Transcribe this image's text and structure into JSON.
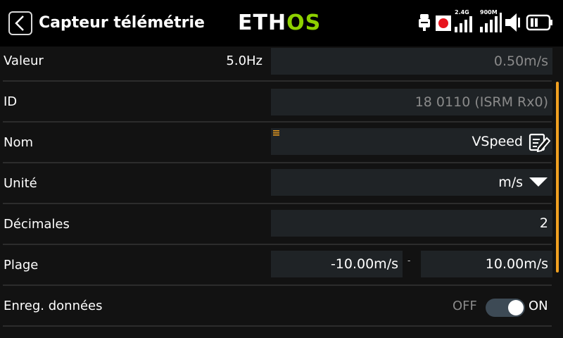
{
  "header": {
    "title": "Capteur télémétrie",
    "logo_part1": "ETH",
    "logo_part2": "OS",
    "signal_24_label": "2.4G",
    "signal_900_label": "900M"
  },
  "rows": {
    "valeur": {
      "label": "Valeur",
      "frequency": "5.0Hz",
      "value": "0.50m/s"
    },
    "id": {
      "label": "ID",
      "value": "18 0110 (ISRM Rx0)"
    },
    "nom": {
      "label": "Nom",
      "value": "VSpeed"
    },
    "unite": {
      "label": "Unité",
      "value": "m/s"
    },
    "decimales": {
      "label": "Décimales",
      "value": "2"
    },
    "plage": {
      "label": "Plage",
      "min": "-10.00m/s",
      "separator": "-",
      "max": "10.00m/s"
    },
    "enreg": {
      "label": "Enreg. données",
      "off_label": "OFF",
      "on_label": "ON",
      "state": "on"
    }
  },
  "colors": {
    "accent_green": "#8ed100",
    "scroll_orange": "#f0a020",
    "field_bg": "#1f2326",
    "record_red": "#e8141e"
  },
  "icons": [
    "back-arrow-icon",
    "usb-icon",
    "record-icon",
    "signal-24-icon",
    "signal-900-icon",
    "volume-icon",
    "battery-icon",
    "edit-icon",
    "dropdown-arrow-icon"
  ]
}
